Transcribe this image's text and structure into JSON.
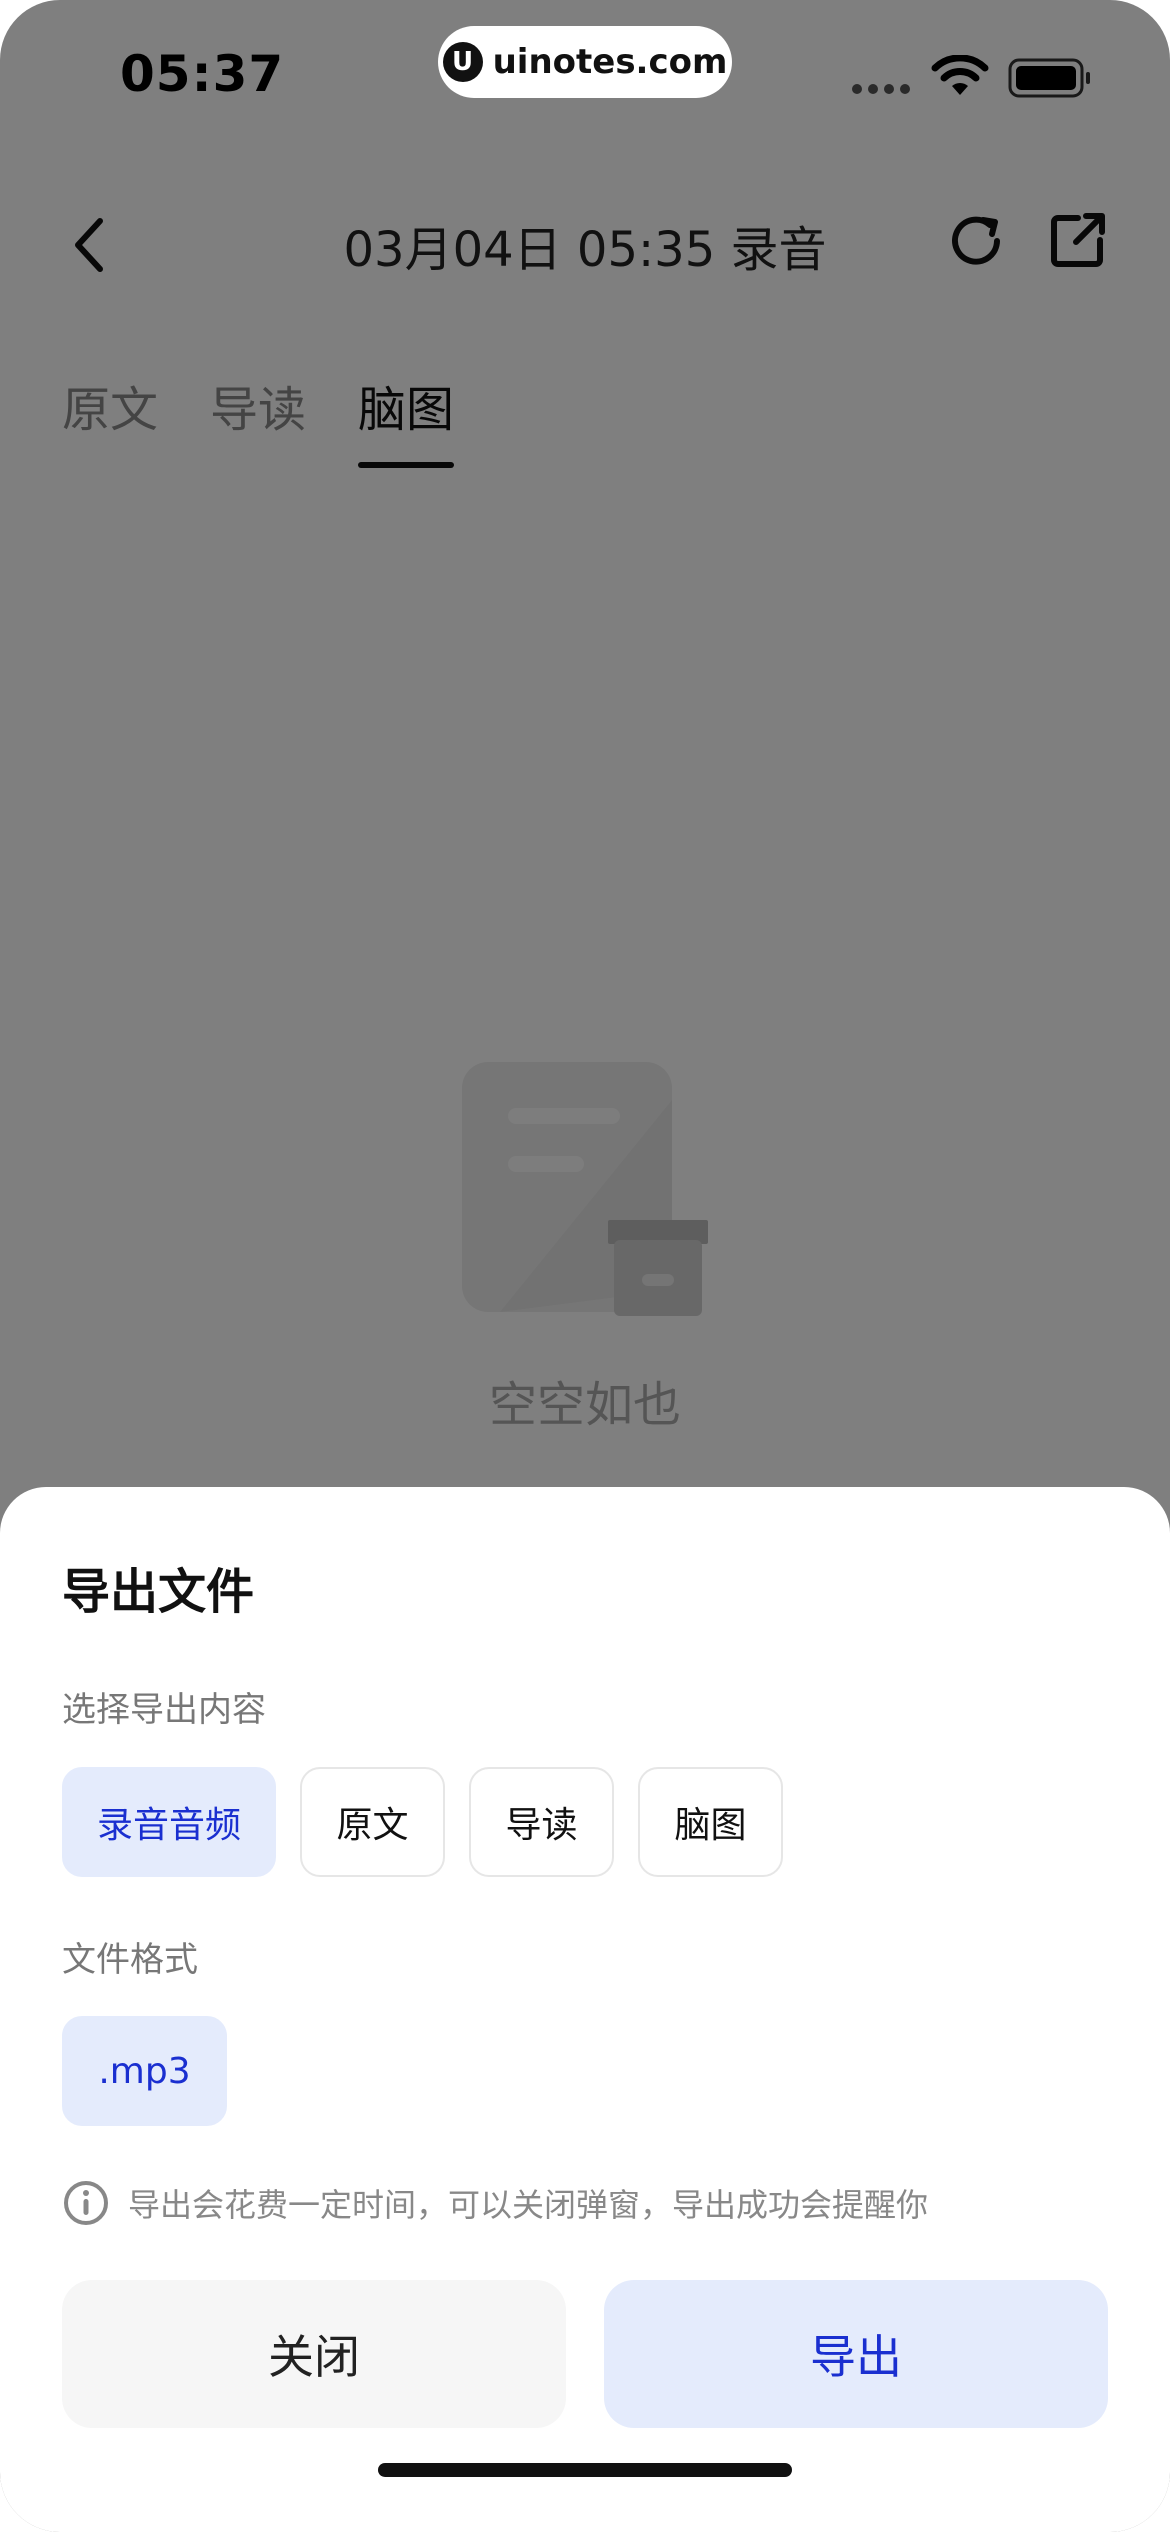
{
  "status_bar": {
    "time": "05:37",
    "url": "uinotes.com",
    "url_logo": "U"
  },
  "nav": {
    "title": "03月04日 05:35 录音"
  },
  "tabs": [
    {
      "label": "原文",
      "active": false
    },
    {
      "label": "导读",
      "active": false
    },
    {
      "label": "脑图",
      "active": true
    }
  ],
  "empty_state": {
    "text": "空空如也",
    "icon": "empty-box-icon"
  },
  "export_sheet": {
    "title": "导出文件",
    "content_label": "选择导出内容",
    "content_options": [
      {
        "label": "录音音频",
        "selected": true
      },
      {
        "label": "原文",
        "selected": false
      },
      {
        "label": "导读",
        "selected": false
      },
      {
        "label": "脑图",
        "selected": false
      }
    ],
    "format_label": "文件格式",
    "format_options": [
      {
        "label": ".mp3",
        "selected": true
      }
    ],
    "note": "导出会花费一定时间，可以关闭弹窗，导出成功会提醒你",
    "close_label": "关闭",
    "export_label": "导出"
  },
  "colors": {
    "accent": "#1a2fd0",
    "accent_bg": "#e4ebfc",
    "overlay": "rgba(0,0,0,0.5)"
  }
}
